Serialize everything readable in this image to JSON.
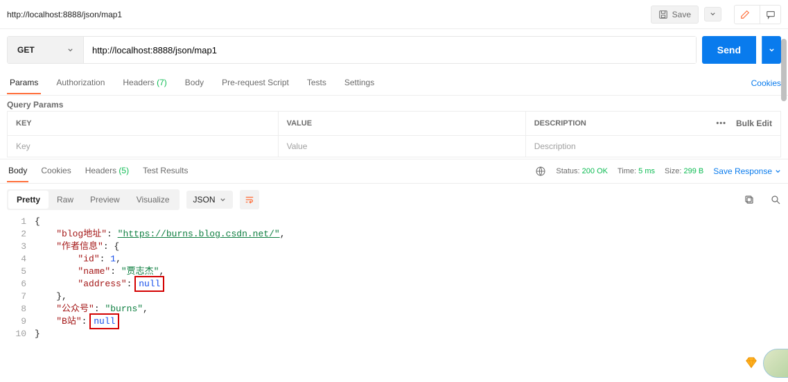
{
  "tab": {
    "title": "http://localhost:8888/json/map1"
  },
  "toolbar": {
    "save_label": "Save"
  },
  "request": {
    "method": "GET",
    "url": "http://localhost:8888/json/map1",
    "send_label": "Send"
  },
  "reqTabs": {
    "params": "Params",
    "authorization": "Authorization",
    "headers": "Headers",
    "headers_count": "(7)",
    "body": "Body",
    "prerequest": "Pre-request Script",
    "tests": "Tests",
    "settings": "Settings",
    "cookies": "Cookies"
  },
  "queryParams": {
    "heading": "Query Params",
    "key_h": "KEY",
    "value_h": "VALUE",
    "desc_h": "DESCRIPTION",
    "bulk": "Bulk Edit",
    "key_ph": "Key",
    "value_ph": "Value",
    "desc_ph": "Description"
  },
  "respTabs": {
    "body": "Body",
    "cookies": "Cookies",
    "headers": "Headers",
    "headers_count": "(5)",
    "test_results": "Test Results"
  },
  "respMeta": {
    "status_lbl": "Status:",
    "status_val": "200 OK",
    "time_lbl": "Time:",
    "time_val": "5 ms",
    "size_lbl": "Size:",
    "size_val": "299 B",
    "save_response": "Save Response"
  },
  "viewer": {
    "pretty": "Pretty",
    "raw": "Raw",
    "preview": "Preview",
    "visualize": "Visualize",
    "format": "JSON"
  },
  "json": {
    "l1": "{",
    "l2_key": "\"blog地址\"",
    "l2_val": "\"https://burns.blog.csdn.net/\"",
    "l3_key": "\"作者信息\"",
    "l4_key": "\"id\"",
    "l4_val": "1",
    "l5_key": "\"name\"",
    "l5_val": "\"贾志杰\"",
    "l6_key": "\"address\"",
    "l6_val": "null",
    "l7": "},",
    "l8_key": "\"公众号\"",
    "l8_val": "\"burns\"",
    "l9_key": "\"B站\"",
    "l9_val": "null",
    "l10": "}"
  },
  "lines": {
    "n1": "1",
    "n2": "2",
    "n3": "3",
    "n4": "4",
    "n5": "5",
    "n6": "6",
    "n7": "7",
    "n8": "8",
    "n9": "9",
    "n10": "10"
  }
}
